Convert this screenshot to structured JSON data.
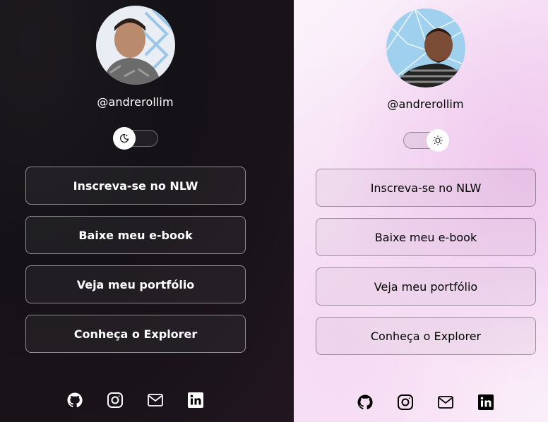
{
  "dark_theme": {
    "username": "@andrerollim",
    "toggle_mode": "dark",
    "links": [
      {
        "label": "Inscreva-se no NLW"
      },
      {
        "label": "Baixe meu e-book"
      },
      {
        "label": "Veja meu portfólio"
      },
      {
        "label": "Conheça o Explorer"
      }
    ],
    "social_icons": [
      "github-icon",
      "instagram-icon",
      "mail-icon",
      "linkedin-icon"
    ]
  },
  "light_theme": {
    "username": "@andrerollim",
    "toggle_mode": "light",
    "links": [
      {
        "label": "Inscreva-se no NLW"
      },
      {
        "label": "Baixe meu e-book"
      },
      {
        "label": "Veja meu portfólio"
      },
      {
        "label": "Conheça o Explorer"
      }
    ],
    "social_icons": [
      "github-icon",
      "instagram-icon",
      "mail-icon",
      "linkedin-icon"
    ]
  },
  "colors": {
    "dark_background": "#141216",
    "light_background": "#f6e1f4",
    "light_accent": "#efc7ee"
  }
}
